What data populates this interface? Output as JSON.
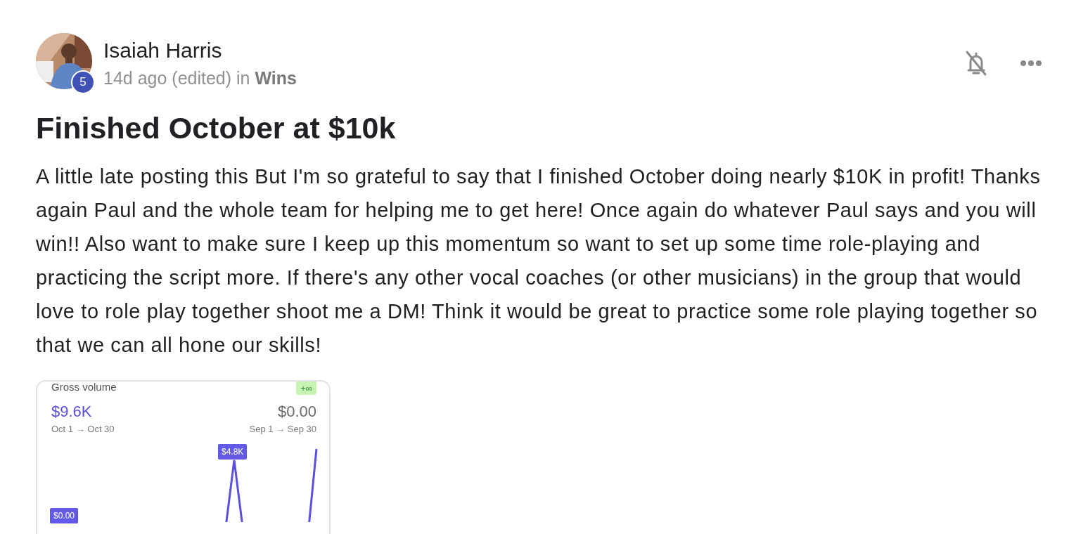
{
  "post": {
    "author": {
      "name": "Isaiah Harris",
      "level_badge": "5",
      "meta": "14d ago (edited) in **Wins**"
    },
    "title": "Finished October at $10k",
    "body": "A little late posting this But I'm so grateful to say that I finished October doing nearly $10K in profit! Thanks again Paul and the whole team for helping me to get here! Once again do whatever Paul says and you will win!! Also want to make sure I keep up this momentum so want to set up some time role-playing and practicing the script more. If there's any other vocal coaches (or other musicians) in the group that would love to role play together shoot me a DM! Think it would be great to practice some role playing together so that we can all hone our skills!",
    "attachment": {
      "label": "Gross volume",
      "change_tag": "+∞",
      "current_value": "$9.6K",
      "current_range": "Oct 1 → Oct 30",
      "previous_value": "$0.00",
      "previous_range": "Sep 1 → Sep 30",
      "point_labels": [
        "$4.8K",
        "$0.00"
      ]
    }
  }
}
